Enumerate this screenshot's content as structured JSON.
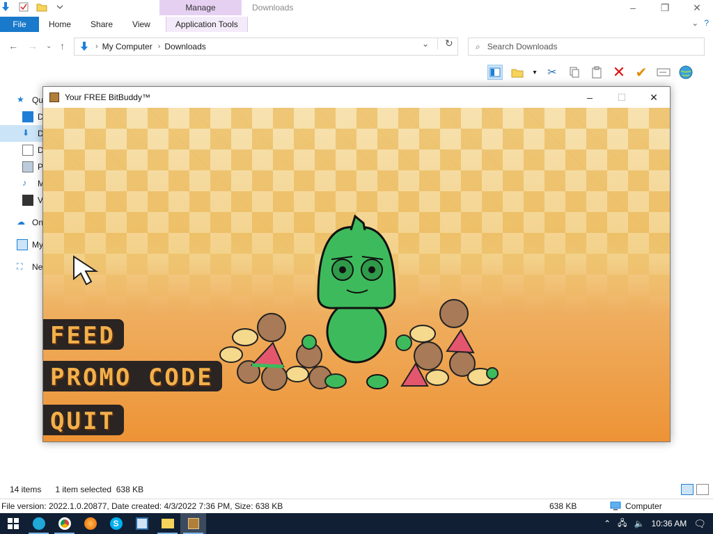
{
  "explorer": {
    "title": "Downloads",
    "manage_tab": "Manage",
    "ribbon_tabs": [
      "File",
      "Home",
      "Share",
      "View",
      "Application Tools"
    ],
    "breadcrumb": [
      "My Computer",
      "Downloads"
    ],
    "search_placeholder": "Search Downloads",
    "nav_items": [
      "Qu",
      "D",
      "D",
      "D",
      "Pi",
      "M",
      "Vi",
      "On",
      "My",
      "Ne"
    ],
    "status": {
      "items_count": "14 items",
      "selected": "1 item selected  638 KB"
    },
    "info": {
      "file_info": "File version: 2022.1.0.20877, Date created: 4/3/2022 7:36 PM, Size: 638 KB",
      "size": "638 KB",
      "location": "Computer"
    }
  },
  "game_window": {
    "title": "Your FREE BitBuddy™",
    "menu": {
      "feed": "FEED",
      "promo": "PROMO CODE",
      "quit": "QUIT"
    }
  },
  "taskbar": {
    "time": "10:36 AM"
  },
  "colors": {
    "accent": "#1979ca",
    "manage_tab": "#e6d0f2",
    "buddy_green": "#3dbb5c",
    "menu_text": "#f3b04a",
    "menu_bg": "#2a2422",
    "taskbar": "#101f33"
  }
}
